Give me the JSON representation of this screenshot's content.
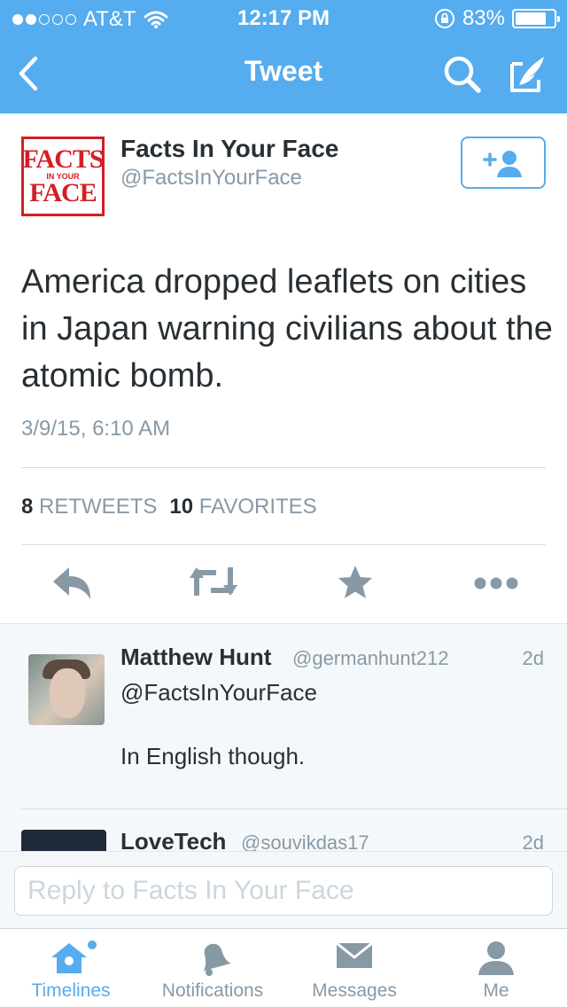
{
  "status_bar": {
    "carrier": "AT&T",
    "signal_bars": 2,
    "time": "12:17 PM",
    "battery": "83%",
    "battery_level": 0.83
  },
  "nav": {
    "title": "Tweet",
    "back_icon": "chevron-left-icon",
    "search_icon": "search-icon",
    "compose_icon": "compose-icon"
  },
  "tweet": {
    "avatar_text": [
      "FACTS",
      "IN YOUR",
      "FACE"
    ],
    "author_name": "Facts In Your Face",
    "author_handle": "@FactsInYourFace",
    "text": "America dropped leaflets on cities in Japan warning civilians about the atomic bomb.",
    "timestamp": "3/9/15, 6:10 AM",
    "retweets_count": "8",
    "retweets_label": "RETWEETS",
    "favorites_count": "10",
    "favorites_label": "FAVORITES"
  },
  "replies": [
    {
      "name": "Matthew Hunt",
      "handle": "@germanhunt212",
      "age": "2d",
      "line1": "@FactsInYourFace",
      "line2": "In English though."
    },
    {
      "name": "LoveTech",
      "handle": "@souvikdas17",
      "age": "2d"
    }
  ],
  "reply_bar": {
    "placeholder": "Reply to Facts In Your Face"
  },
  "tabs": [
    {
      "label": "Timelines",
      "icon": "home-icon",
      "active": true
    },
    {
      "label": "Notifications",
      "icon": "bell-icon",
      "active": false
    },
    {
      "label": "Messages",
      "icon": "envelope-icon",
      "active": false
    },
    {
      "label": "Me",
      "icon": "person-icon",
      "active": false
    }
  ],
  "colors": {
    "brand": "#55acee",
    "text": "#292f33",
    "muted": "#8899a6",
    "logo_red": "#d41f26"
  }
}
